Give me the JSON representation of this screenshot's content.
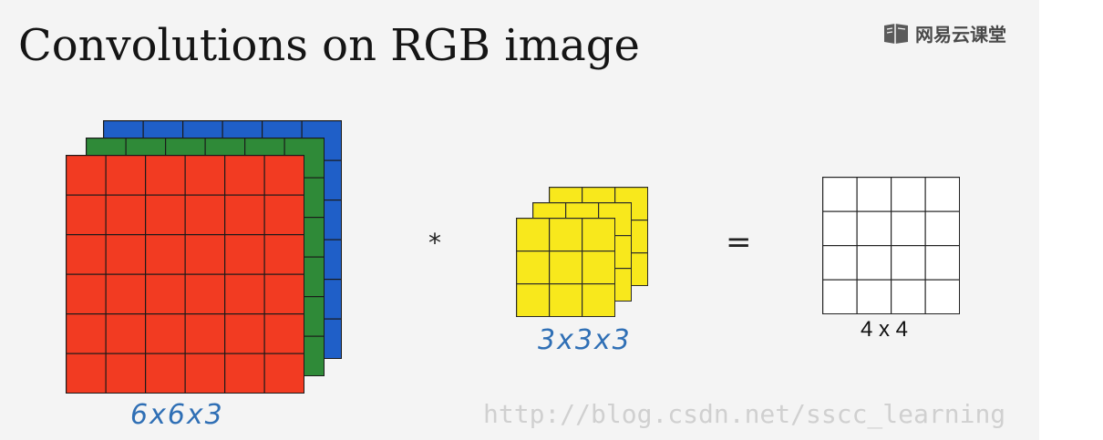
{
  "title": "Convolutions on RGB image",
  "brand": {
    "text": "网易云课堂",
    "icon": "book-icon"
  },
  "operators": {
    "convolve": "*",
    "equals": "="
  },
  "input": {
    "label": "6x6x3",
    "rows": 6,
    "cols": 6,
    "channels": [
      {
        "name": "blue",
        "color": "#1f5fc8"
      },
      {
        "name": "green",
        "color": "#2f8a38"
      },
      {
        "name": "red",
        "color": "#f23b22"
      }
    ]
  },
  "filter": {
    "label": "3x3x3",
    "rows": 3,
    "cols": 3,
    "layers": 3,
    "color": "#f8e81c"
  },
  "output": {
    "label": "4 x 4",
    "rows": 4,
    "cols": 4,
    "color": "#ffffff"
  },
  "watermark": "http://blog.csdn.net/sscc_learning"
}
